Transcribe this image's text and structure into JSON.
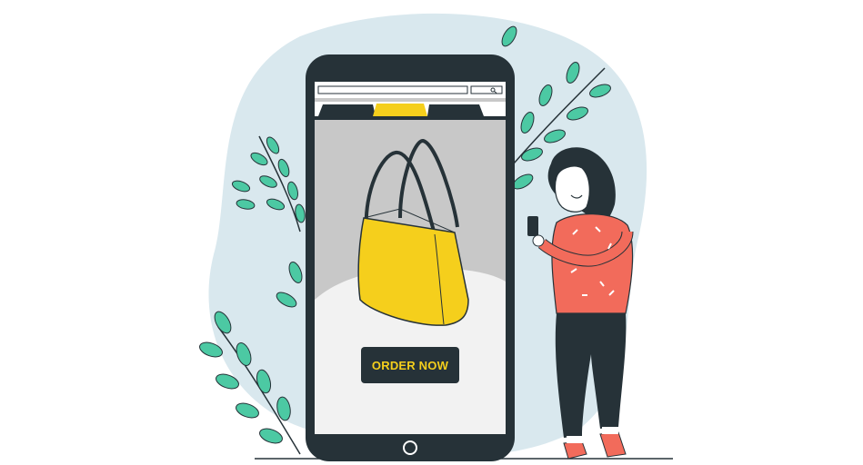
{
  "colors": {
    "background": "#ffffff",
    "blob": "#d9e8ee",
    "leaf": "#4cc9a3",
    "phone_frame": "#263238",
    "screen_bg": "#c8c8c8",
    "screen_bottom": "#f2f2f2",
    "bag_yellow": "#f5cf1c",
    "outline": "#263238",
    "woman_top": "#f26b5b",
    "woman_pants": "#263238",
    "shoes": "#f26b5b"
  },
  "icons": {
    "search": "search-icon",
    "home_button": "home-button-icon",
    "bag": "tote-bag-icon"
  },
  "screen": {
    "order_button_label": "ORDER NOW"
  }
}
